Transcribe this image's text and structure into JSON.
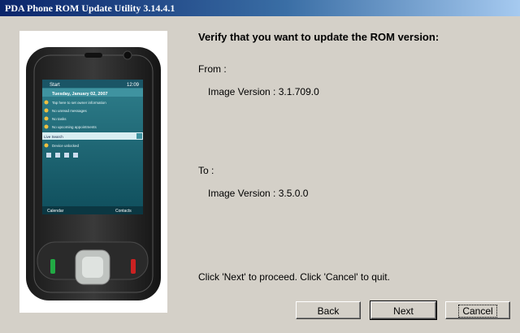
{
  "window": {
    "title": "PDA Phone ROM Update Utility 3.14.4.1"
  },
  "main": {
    "heading": "Verify that you want to update the ROM version:",
    "from_label": "From :",
    "from_version": "Image Version : 3.1.709.0",
    "to_label": "To :",
    "to_version": "Image Version : 3.5.0.0",
    "instructions": "Click 'Next' to proceed. Click 'Cancel' to quit."
  },
  "phone_screen": {
    "start": "Start",
    "time": "12:09",
    "date": "Tuesday, January 02, 2007",
    "owner": "Tap here to set owner information",
    "messages": "No unread messages",
    "tasks": "No tasks",
    "appointments": "No upcoming appointments",
    "search": "Live Search",
    "device": "Device unlocked",
    "softkey_left": "Calendar",
    "softkey_right": "Contacts"
  },
  "buttons": {
    "back": "Back",
    "next": "Next",
    "cancel": "Cancel"
  }
}
